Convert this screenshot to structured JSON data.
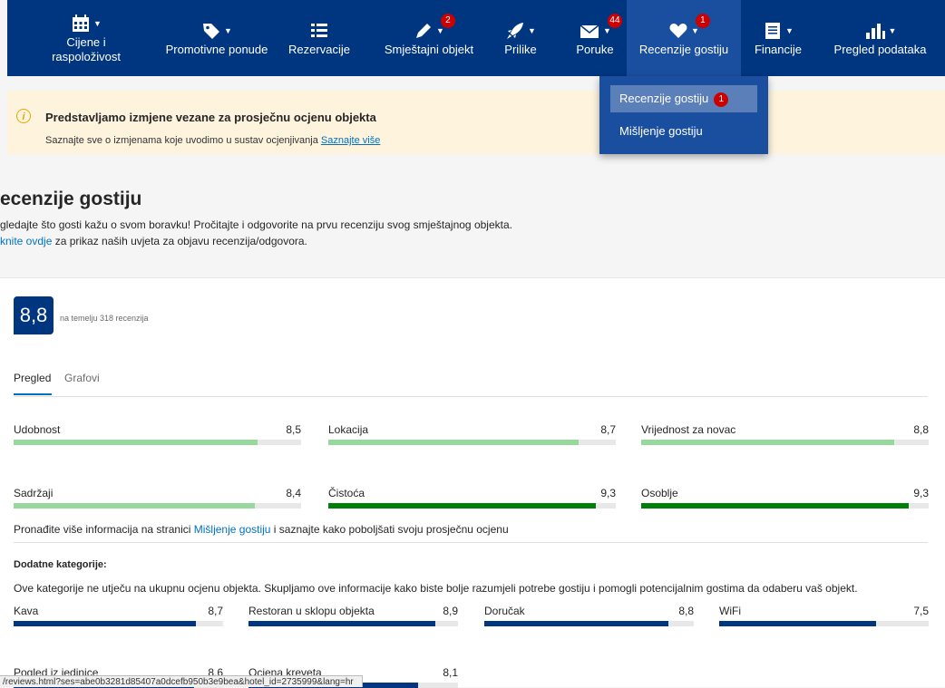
{
  "nav": {
    "items": [
      {
        "label": "Cijene i raspoloživost",
        "icon": "calendar-icon",
        "caret": true,
        "badge": ""
      },
      {
        "label": "Promotivne ponude",
        "icon": "tag-icon",
        "caret": true,
        "badge": ""
      },
      {
        "label": "Rezervacije",
        "icon": "list-icon",
        "caret": false,
        "badge": ""
      },
      {
        "label": "Smještajni objekt",
        "icon": "pencil-icon",
        "caret": true,
        "badge": "2"
      },
      {
        "label": "Prilike",
        "icon": "rocket-icon",
        "caret": true,
        "badge": ""
      },
      {
        "label": "Poruke",
        "icon": "envelope-icon",
        "caret": true,
        "badge": "44"
      },
      {
        "label": "Recenzije gostiju",
        "icon": "heart-icon",
        "caret": true,
        "badge": "1",
        "active": true
      },
      {
        "label": "Financije",
        "icon": "ledger-icon",
        "caret": true,
        "badge": ""
      },
      {
        "label": "Pregled podataka",
        "icon": "bar-chart-icon",
        "caret": true,
        "badge": ""
      }
    ],
    "dropdown": {
      "items": [
        {
          "label": "Recenzije gostiju",
          "badge": "1"
        },
        {
          "label": "Mišljenje gostiju"
        }
      ]
    }
  },
  "notice": {
    "title": "Predstavljamo izmjene vezane za prosječnu ocjenu objekta",
    "text": "Saznajte sve o izmjenama koje uvodimo u sustav ocjenjivanja",
    "link": "Saznajte više"
  },
  "page": {
    "title": "ecenzije gostiju",
    "subtitle": "gledajte što gosti kažu o svom boravku! Pročitajte i odgovorite na prvu recenziju svog smještajnog objekta.",
    "terms_link": "knite ovdje",
    "terms_text": " za prikaz naših uvjeta za objavu recenzija/odgovora."
  },
  "score": {
    "value": "8,8",
    "text": "na temelju 318 recenzija"
  },
  "tabs": [
    "Pregled",
    "Grafovi"
  ],
  "categories": [
    {
      "label": "Udobnost",
      "value": "8,5",
      "score": 8.5,
      "color": "#97d89d"
    },
    {
      "label": "Lokacija",
      "value": "8,7",
      "score": 8.7,
      "color": "#97d89d"
    },
    {
      "label": "Vrijednost za novac",
      "value": "8,8",
      "score": 8.8,
      "color": "#97d89d"
    },
    {
      "label": "Sadržaji",
      "value": "8,4",
      "score": 8.4,
      "color": "#97d89d"
    },
    {
      "label": "Čistoća",
      "value": "9,3",
      "score": 9.3,
      "color": "#008009"
    },
    {
      "label": "Osoblje",
      "value": "9,3",
      "score": 9.3,
      "color": "#008009"
    }
  ],
  "more_info": {
    "prefix": "Pronađite više informacija na stranici ",
    "link": "Mišljenje gostiju",
    "suffix": " i saznajte kako poboljšati svoju prosječnu ocjenu"
  },
  "additional": {
    "title": "Dodatne kategorije:",
    "description": "Ove kategorije ne utječu na ukupnu ocjenu objekta. Skupljamo ove informacije kako biste bolje razumjeli potrebe gostiju i pomogli potencijalnim gostima da odaberu vaš objekt.",
    "items": [
      {
        "label": "Kava",
        "value": "8,7",
        "score": 8.7
      },
      {
        "label": "Restoran u sklopu objekta",
        "value": "8,9",
        "score": 8.9
      },
      {
        "label": "Doručak",
        "value": "8,8",
        "score": 8.8
      },
      {
        "label": "WiFi",
        "value": "7,5",
        "score": 7.5
      },
      {
        "label": "Pogled iz jedinice",
        "value": "8,6",
        "score": 8.6
      },
      {
        "label": "Ocjena kreveta",
        "value": "8,1",
        "score": 8.1
      }
    ]
  },
  "statusbar": {
    "url": "/reviews.html?ses=abe0b3281d85407a0dcefb950b3e9bea&hotel_id=2735999&lang=hr"
  },
  "colors": {
    "nav_bg": "#003580",
    "nav_active": "#1a4fa0",
    "link": "#0071c2",
    "badge": "#cc0000",
    "bar_light_green": "#97d89d",
    "bar_green": "#008009",
    "bar_blue": "#003580"
  }
}
